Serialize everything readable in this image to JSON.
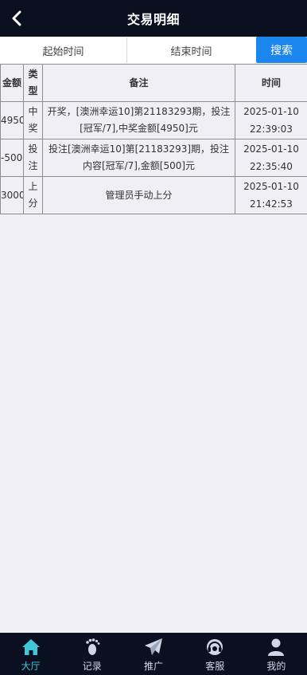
{
  "header": {
    "title": "交易明细"
  },
  "filter": {
    "start_label": "起始时间",
    "end_label": "结束时间",
    "search_label": "搜索"
  },
  "table": {
    "columns": [
      "金额",
      "类型",
      "备注",
      "时间"
    ],
    "rows": [
      {
        "amount": "4950",
        "type": "中奖",
        "note": "开奖，[澳洲幸运10]第21183293期，投注[冠军/7],中奖金额[4950]元",
        "date": "2025-01-10",
        "time": "22:39:03"
      },
      {
        "amount": "-500",
        "type": "投注",
        "note": "投注[澳洲幸运10]第[21183293]期，投注内容[冠军/7],金额[500]元",
        "date": "2025-01-10",
        "time": "22:35:40"
      },
      {
        "amount": "3000",
        "type": "上分",
        "note": "管理员手动上分",
        "date": "2025-01-10",
        "time": "21:42:53"
      }
    ]
  },
  "tabbar": {
    "items": [
      {
        "label": "大厅",
        "icon": "home-icon",
        "active": true
      },
      {
        "label": "记录",
        "icon": "footprint-icon",
        "active": false
      },
      {
        "label": "推广",
        "icon": "paper-plane-icon",
        "active": false
      },
      {
        "label": "客服",
        "icon": "headset-icon",
        "active": false
      },
      {
        "label": "我的",
        "icon": "user-icon",
        "active": false
      }
    ]
  },
  "colors": {
    "header_bg": "#0b1021",
    "accent": "#1a86ee",
    "active_tab": "#3fc7d6",
    "page_bg": "#efeff4"
  }
}
